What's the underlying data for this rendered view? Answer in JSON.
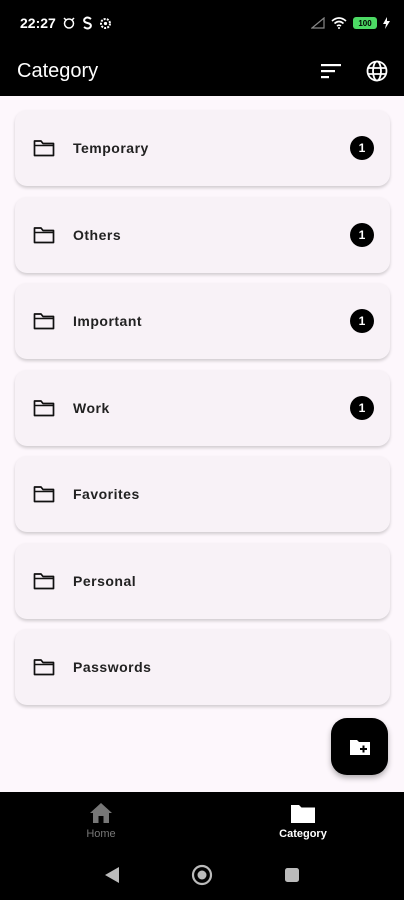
{
  "status_bar": {
    "time": "22:27",
    "battery_level": "100"
  },
  "app_bar": {
    "title": "Category",
    "sort_icon": "sort-icon",
    "language_icon": "globe-icon"
  },
  "categories": [
    {
      "label": "Temporary",
      "count": "1"
    },
    {
      "label": "Others",
      "count": "1"
    },
    {
      "label": "Important",
      "count": "1"
    },
    {
      "label": "Work",
      "count": "1"
    },
    {
      "label": "Favorites",
      "count": ""
    },
    {
      "label": "Personal",
      "count": ""
    },
    {
      "label": "Passwords",
      "count": ""
    }
  ],
  "fab": {
    "icon": "folder-add-icon"
  },
  "bottom_nav": {
    "items": [
      {
        "label": "Home",
        "icon": "home-icon",
        "active": false
      },
      {
        "label": "Category",
        "icon": "folder-icon",
        "active": true
      }
    ]
  },
  "colors": {
    "background": "#fdf7fc",
    "card": "#f8f2f7",
    "bar": "#000000",
    "badge": "#000000"
  }
}
